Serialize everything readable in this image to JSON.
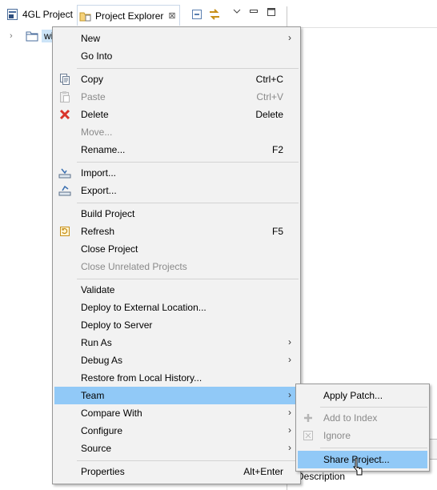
{
  "tabs": {
    "tab1_label": "4GL Project",
    "tab2_label": "Project Explorer",
    "close_glyph": "⊠"
  },
  "tree": {
    "item_label": "wi",
    "twisty": "›"
  },
  "panel": {
    "description_label": "Description"
  },
  "context_menu": {
    "items": [
      {
        "label": "New",
        "arrow": "›"
      },
      {
        "label": "Go Into"
      },
      {
        "label": "Copy",
        "accel": "Ctrl+C",
        "icon": "copy-icon"
      },
      {
        "label": "Paste",
        "accel": "Ctrl+V",
        "icon": "paste-icon"
      },
      {
        "label": "Delete",
        "accel": "Delete",
        "icon": "delete-icon"
      },
      {
        "label": "Move..."
      },
      {
        "label": "Rename...",
        "accel": "F2"
      },
      {
        "label": "Import...",
        "icon": "import-icon"
      },
      {
        "label": "Export...",
        "icon": "export-icon"
      },
      {
        "label": "Build Project"
      },
      {
        "label": "Refresh",
        "accel": "F5",
        "icon": "refresh-icon"
      },
      {
        "label": "Close Project"
      },
      {
        "label": "Close Unrelated Projects"
      },
      {
        "label": "Validate"
      },
      {
        "label": "Deploy to External Location..."
      },
      {
        "label": "Deploy to Server"
      },
      {
        "label": "Run As",
        "arrow": "›"
      },
      {
        "label": "Debug As",
        "arrow": "›"
      },
      {
        "label": "Restore from Local History..."
      },
      {
        "label": "Team",
        "arrow": "›"
      },
      {
        "label": "Compare With",
        "arrow": "›"
      },
      {
        "label": "Configure",
        "arrow": "›"
      },
      {
        "label": "Source",
        "arrow": "›"
      },
      {
        "label": "Properties",
        "accel": "Alt+Enter"
      }
    ]
  },
  "team_submenu": {
    "items": [
      {
        "label": "Apply Patch..."
      },
      {
        "label": "Add to Index",
        "icon": "add-icon"
      },
      {
        "label": "Ignore",
        "icon": "ignore-icon"
      },
      {
        "label": "Share Project..."
      }
    ]
  },
  "colors": {
    "menu_bg": "#f2f2f2",
    "highlight": "#91c9f7",
    "disabled_text": "#8a8a8a",
    "selection": "#cce4f7"
  }
}
